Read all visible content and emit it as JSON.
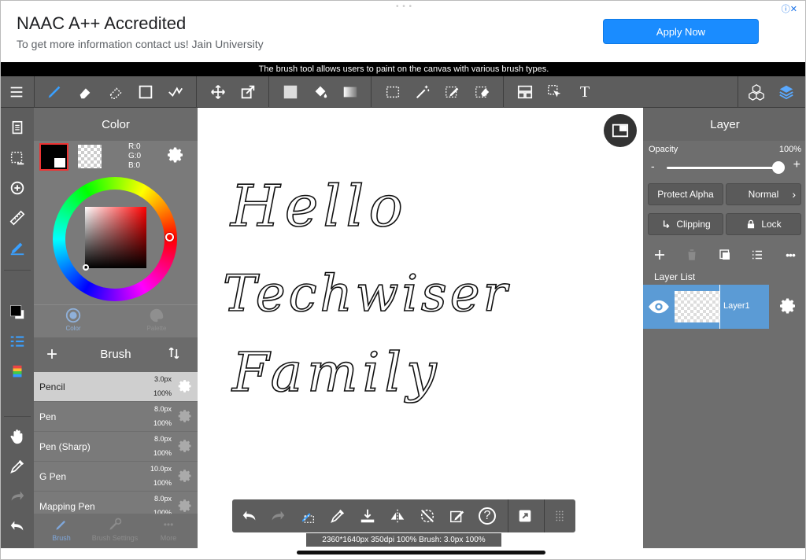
{
  "ad": {
    "title": "NAAC A++ Accredited",
    "subtitle": "To get more information contact us! Jain University",
    "button_label": "Apply Now",
    "info_icon": "ad-info-icon"
  },
  "tip": "The brush tool allows users to paint on the canvas with various brush types.",
  "toolbar": {
    "icons": [
      "menu-icon",
      "brush-icon",
      "eraser-icon",
      "blur-eraser-icon",
      "rectangle-icon",
      "stabilizer-icon",
      "move-icon",
      "transform-icon",
      "fill-color-icon",
      "bucket-icon",
      "gradient-icon",
      "select-rect-icon",
      "magic-wand-icon",
      "select-pen-icon",
      "select-eraser-icon",
      "layout-icon",
      "select-cursor-icon",
      "text-icon",
      "material-icon",
      "layers-icon"
    ],
    "text_tool_glyph": "T"
  },
  "rail": {
    "icons": [
      "pages-icon",
      "selection-icon",
      "snap-icon",
      "ruler-icon",
      "fill-icon",
      "color-swatch-icon",
      "layer-list-icon",
      "color-bars-icon",
      "hand-icon",
      "eyedropper-icon",
      "redo-icon",
      "undo-icon"
    ]
  },
  "color": {
    "title": "Color",
    "rgb": [
      "R:0",
      "G:0",
      "B:0"
    ],
    "primary": "#000000",
    "secondary": "#ffffff",
    "tabs": [
      {
        "label": "Color",
        "icon": "color-circle-icon"
      },
      {
        "label": "Palette",
        "icon": "palette-icon"
      }
    ]
  },
  "brush": {
    "title": "Brush",
    "add": "+",
    "items": [
      {
        "name": "Pencil",
        "size": "3.0px",
        "opacity": "100%",
        "selected": true
      },
      {
        "name": "Pen",
        "size": "8.0px",
        "opacity": "100%"
      },
      {
        "name": "Pen (Sharp)",
        "size": "8.0px",
        "opacity": "100%"
      },
      {
        "name": "G Pen",
        "size": "10.0px",
        "opacity": "100%"
      },
      {
        "name": "Mapping Pen",
        "size": "8.0px",
        "opacity": "100%"
      }
    ],
    "tabs": [
      {
        "label": "Brush",
        "icon": "brush-tab-icon"
      },
      {
        "label": "Brush Settings",
        "icon": "brush-settings-icon"
      },
      {
        "label": "More",
        "icon": "more-icon"
      }
    ],
    "more_glyph": "•••"
  },
  "canvas": {
    "lines": [
      "Hello",
      "Techwiser",
      "Family"
    ]
  },
  "bottombar": {
    "icons": [
      "undo-icon",
      "redo-icon",
      "transform-select-icon",
      "eyedropper-icon",
      "save-icon",
      "flip-icon",
      "rotate-reset-icon",
      "snap-off-icon",
      "help-icon",
      "quick-menu-icon",
      "grid-icon"
    ],
    "help_glyph": "?"
  },
  "status": "2360*1640px 350dpi 100% Brush: 3.0px 100%",
  "layer": {
    "title": "Layer",
    "opacity_label": "Opacity",
    "opacity_value": "100%",
    "opacity": 1.0,
    "minus": "-",
    "plus": "+",
    "protect_alpha": "Protect Alpha",
    "blend_mode": "Normal",
    "clipping": "Clipping",
    "lock": "Lock",
    "list_label": "Layer List",
    "layers": [
      {
        "name": "Layer1",
        "visible": true
      }
    ]
  }
}
